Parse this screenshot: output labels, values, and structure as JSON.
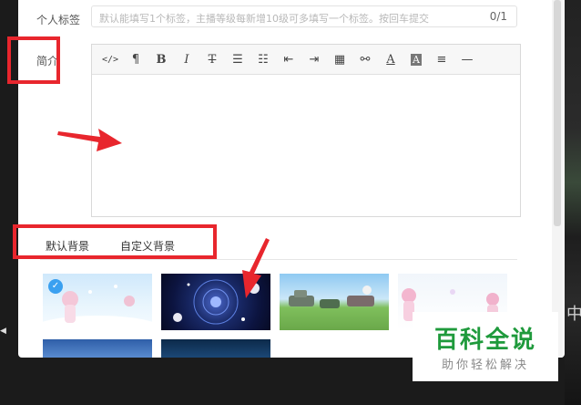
{
  "form": {
    "tag_label": "个人标签",
    "tag_placeholder": "默认能填写1个标签，主播等级每新增10级可多填写一个标签。按回车提交",
    "tag_count": "0/1",
    "intro_label": "简介"
  },
  "toolbar": {
    "code": "</>",
    "paragraph": "¶",
    "bold": "B",
    "italic": "I",
    "strike": "T",
    "bullet": "☰",
    "numbered": "☷",
    "outdent": "⇤",
    "indent": "⇥",
    "table": "▦",
    "link": "⚯",
    "font_color": "A",
    "bg_color": "A",
    "align": "≡",
    "hr": "—"
  },
  "background_tabs": {
    "default": "默认背景",
    "custom": "自定义背景"
  },
  "watermark": {
    "title": "百科全说",
    "subtitle": "助你轻松解决"
  },
  "colors": {
    "annotation_red": "#e8262d",
    "selected_badge": "#3aa0f0",
    "watermark_green": "#1f9a3c"
  }
}
